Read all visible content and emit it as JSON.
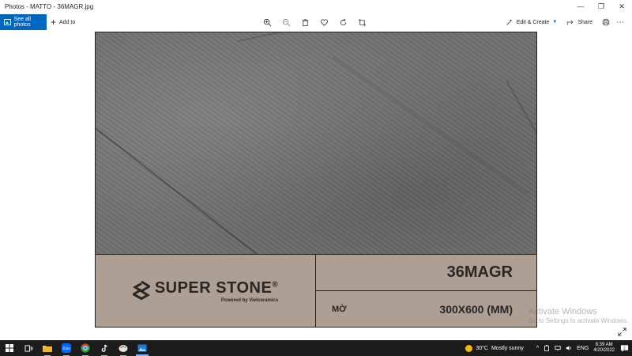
{
  "window": {
    "title": "Photos - MATTO - 36MAGR.jpg",
    "minimize": "—",
    "maximize": "❐",
    "close": "✕"
  },
  "toolbar": {
    "see_all_photos": "See all photos",
    "add_to": "Add to",
    "edit_create": "Edit & Create",
    "share": "Share",
    "more": "⋯",
    "tools": [
      "zoom-in-icon",
      "zoom-out-icon",
      "delete-icon",
      "favorite-icon",
      "rotate-icon",
      "crop-icon"
    ]
  },
  "photo": {
    "brand": "SUPER STONE",
    "registered": "®",
    "brand_sub": "Powered by Vietceramics",
    "code": "36MAGR",
    "finish": "MỜ",
    "size": "300X600 (MM)",
    "stone_color": "#707070",
    "panel_color": "#ad9f94"
  },
  "watermark": {
    "line1": "Activate Windows",
    "line2": "Go to Settings to activate Windows."
  },
  "taskbar": {
    "weather_temp": "30°C",
    "weather_text": "Mostly sunny",
    "language": "ENG",
    "time": "8:39 AM",
    "date": "4/20/2022",
    "notifications": "2"
  }
}
